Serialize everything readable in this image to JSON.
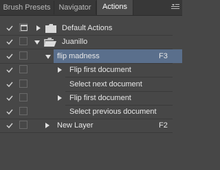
{
  "tabs": [
    {
      "label": "Brush Presets"
    },
    {
      "label": "Navigator"
    },
    {
      "label": "Actions"
    }
  ],
  "actions": {
    "default_set": {
      "label": "Default Actions"
    },
    "juanillo_set": {
      "label": "Juanillo"
    },
    "flip_madness": {
      "label": "flip madness",
      "shortcut": "F3"
    },
    "steps": [
      {
        "label": "Flip first document"
      },
      {
        "label": "Select next document"
      },
      {
        "label": "Flip first document"
      },
      {
        "label": "Select previous document"
      }
    ],
    "new_layer": {
      "label": "New Layer",
      "shortcut": "F2"
    }
  },
  "colors": {
    "panel_bg": "#474747",
    "tab_bar_bg": "#383838",
    "selection": "#5a6f8c"
  }
}
